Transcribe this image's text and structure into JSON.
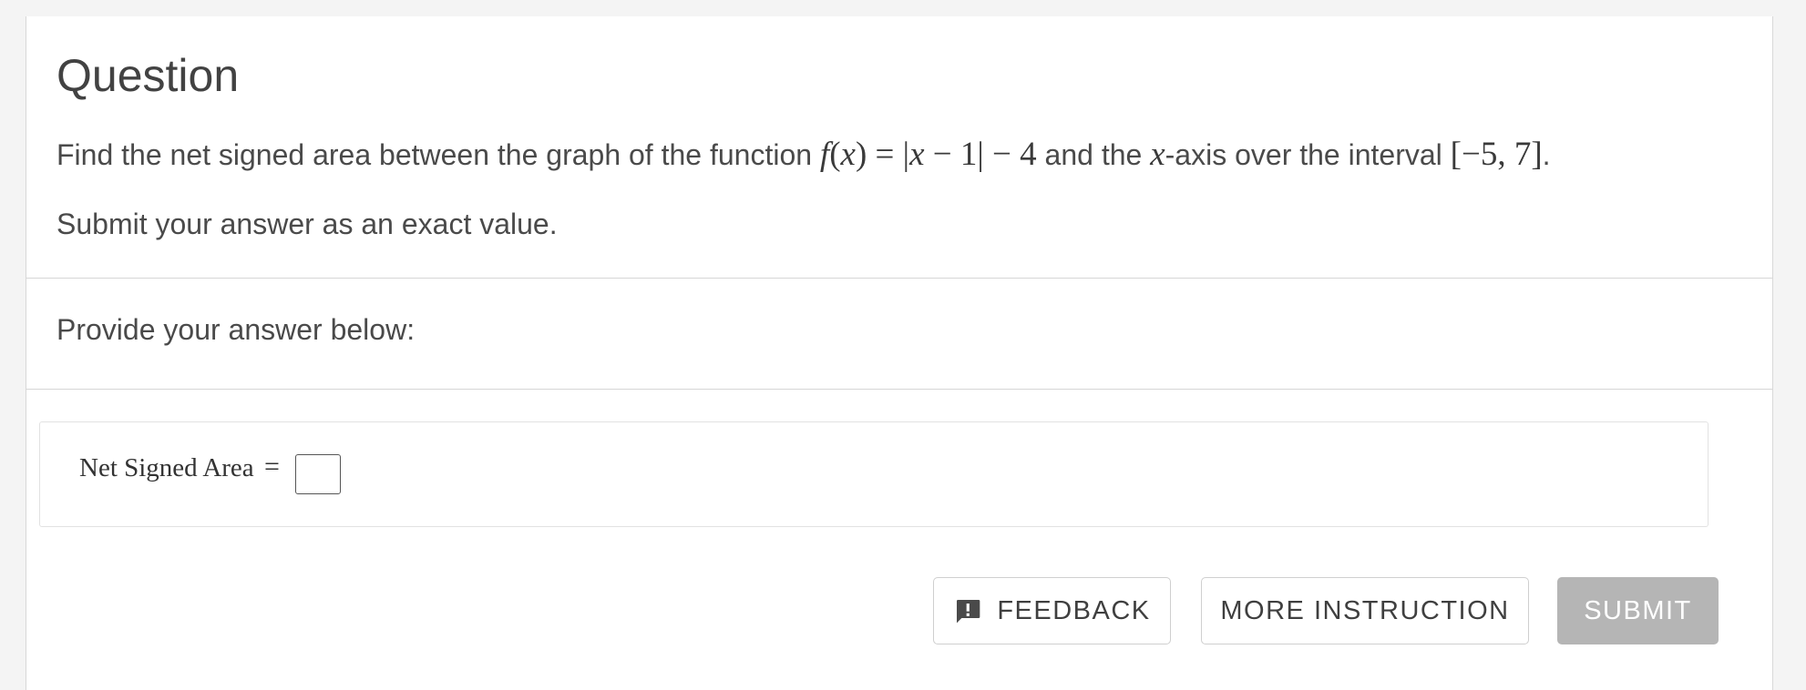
{
  "question": {
    "title": "Question",
    "text_before": "Find the net signed area between the graph of the function ",
    "text_middle": " and the ",
    "text_after": "-axis over the interval ",
    "text_end": ".",
    "function_name": "f",
    "function_arg": "x",
    "function_body": " = |",
    "function_var": "x",
    "function_rest": " − 1| − 4",
    "axis_var": "x",
    "interval": "[−5, 7]",
    "instruction": "Submit your answer as an exact value."
  },
  "answer_section": {
    "prompt": "Provide your answer below:",
    "label": "Net Signed Area",
    "equals": "=",
    "value": ""
  },
  "buttons": {
    "feedback": "FEEDBACK",
    "more_instruction": "MORE INSTRUCTION",
    "submit": "SUBMIT"
  },
  "icons": {
    "feedback": "feedback-exclamation-icon"
  },
  "colors": {
    "submit_disabled": "#b5b5b5",
    "border": "#d6d6d6"
  }
}
